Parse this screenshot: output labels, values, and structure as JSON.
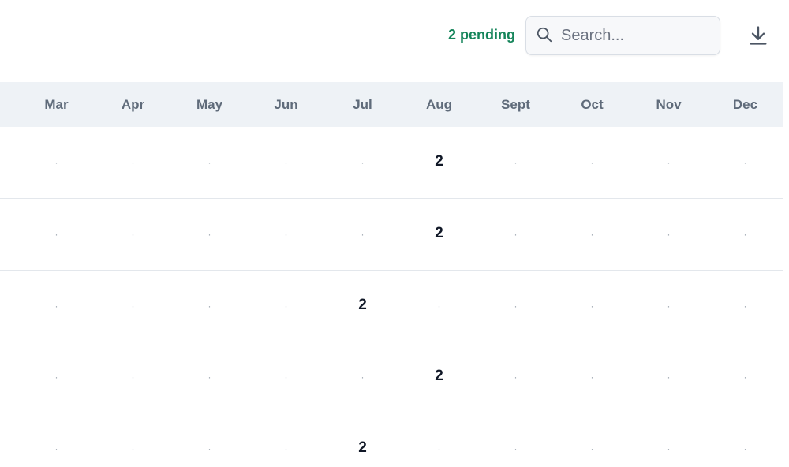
{
  "toolbar": {
    "pending_label": "2 pending",
    "search_placeholder": "Search..."
  },
  "months": [
    "Mar",
    "Apr",
    "May",
    "Jun",
    "Jul",
    "Aug",
    "Sept",
    "Oct",
    "Nov",
    "Dec"
  ],
  "rows": [
    [
      "·",
      "·",
      "·",
      "·",
      "·",
      "2",
      "·",
      "·",
      "·",
      "·"
    ],
    [
      "·",
      "·",
      "·",
      "·",
      "·",
      "2",
      "·",
      "·",
      "·",
      "·"
    ],
    [
      "·",
      "·",
      "·",
      "·",
      "2",
      "·",
      "·",
      "·",
      "·",
      "·"
    ],
    [
      "·",
      "·",
      "·",
      "·",
      "·",
      "2",
      "·",
      "·",
      "·",
      "·"
    ],
    [
      "·",
      "·",
      "·",
      "·",
      "2",
      "·",
      "·",
      "·",
      "·",
      "·"
    ]
  ],
  "icons": {
    "search": "search-icon",
    "download": "download-icon"
  }
}
